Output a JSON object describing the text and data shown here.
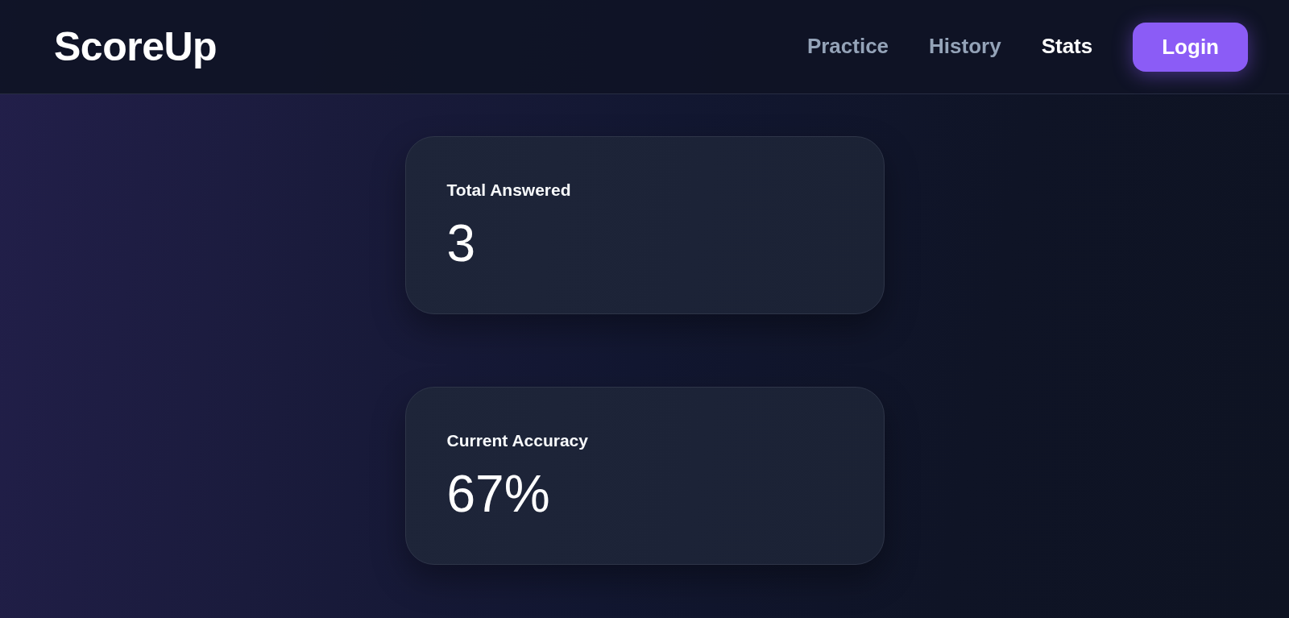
{
  "header": {
    "logo": "ScoreUp",
    "nav": [
      {
        "label": "Practice",
        "selected": false
      },
      {
        "label": "History",
        "selected": false
      },
      {
        "label": "Stats",
        "selected": true
      }
    ],
    "login_button": "Login"
  },
  "stats": [
    {
      "label": "Total Answered",
      "value": "3"
    },
    {
      "label": "Current Accuracy",
      "value": "67%"
    }
  ]
}
